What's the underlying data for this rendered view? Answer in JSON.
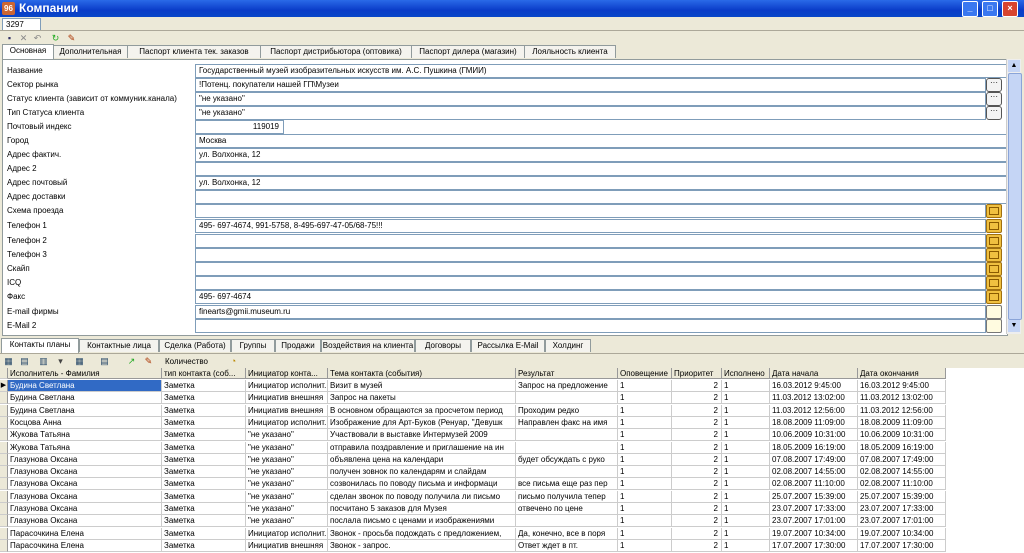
{
  "window": {
    "title": "Компании",
    "app_icon_text": "96",
    "record_id": "3297"
  },
  "tabs": [
    "Основная",
    "Дополнительная",
    "Паспорт клиента тек. заказов",
    "Паспорт дистрибьютора (оптовика)",
    "Паспорт дилера (магазин)",
    "Лояльность клиента"
  ],
  "fields": [
    {
      "label": "Название",
      "value": "Государственный музей изобразительных искусств им. А.С. Пушкина (ГМИИ)",
      "btn": ""
    },
    {
      "label": "Сектор рынка",
      "value": "!Потенц. покупатели нашей ГП\\Музеи",
      "btn": "dots"
    },
    {
      "label": "Статус клиента (зависит от коммуник.канала)",
      "value": "\"не указано\"",
      "btn": "dots"
    },
    {
      "label": "Тип Статуса клиента",
      "value": "\"не указано\"",
      "btn": "dots"
    },
    {
      "label": "Почтовый индекс",
      "value": "119019",
      "btn": ""
    },
    {
      "label": "Город",
      "value": "Москва",
      "btn": ""
    },
    {
      "label": "Адрес фактич.",
      "value": "ул. Волхонка, 12",
      "btn": ""
    },
    {
      "label": "Адрес 2",
      "value": "",
      "btn": ""
    },
    {
      "label": "Адрес почтовый",
      "value": "ул. Волхонка, 12",
      "btn": ""
    },
    {
      "label": "Адрес доставки",
      "value": "",
      "btn": ""
    },
    {
      "label": "Схема проезда",
      "value": "",
      "btn": "env"
    },
    {
      "label": "Телефон 1",
      "value": "495- 697-4674, 991-5758,  8-495-697-47-05/68-75!!!",
      "btn": "env"
    },
    {
      "label": "Телефон 2",
      "value": "",
      "btn": "env"
    },
    {
      "label": "Телефон 3",
      "value": "",
      "btn": "env"
    },
    {
      "label": "Скайп",
      "value": "",
      "btn": "env"
    },
    {
      "label": "ICQ",
      "value": "",
      "btn": "env"
    },
    {
      "label": "Факс",
      "value": "495- 697-4674",
      "btn": "env"
    },
    {
      "label": "E-mail фирмы",
      "value": "finearts@gmii.museum.ru",
      "btn": "page"
    },
    {
      "label": "E-Mail 2",
      "value": "",
      "btn": "page"
    }
  ],
  "bottom_tabs": [
    "Контакты планы",
    "Контактные лица",
    "Сделка (Работа)",
    "Группы",
    "Продажи",
    "Воздействия на клиента",
    "Договоры",
    "Рассылка E-Mail",
    "Холдинг"
  ],
  "bottom_toolbar": {
    "count_label": "Количество"
  },
  "grid": {
    "columns": [
      "Исполнитель - Фамилия",
      "тип контакта (соб...",
      "Инициатор конта...",
      "Тема контакта (события)",
      "Результат",
      "Оповещение",
      "Приоритет",
      "Исполнено",
      "Дата начала",
      "Дата окончания"
    ],
    "rows": [
      [
        "Будина Светлана",
        "Заметка",
        "Инициатор исполнит.",
        "Визит в музей",
        "Запрос на предложение",
        "1",
        "2",
        "1",
        "16.03.2012 9:45:00",
        "16.03.2012 9:45:00"
      ],
      [
        "Будина Светлана",
        "Заметка",
        "Инициатив внешняя",
        "Запрос на пакеты",
        "",
        "1",
        "2",
        "1",
        "11.03.2012 13:02:00",
        "11.03.2012 13:02:00"
      ],
      [
        "Будина Светлана",
        "Заметка",
        "Инициатив внешняя",
        "В основном обращаются за просчетом период",
        "Проходим редко",
        "1",
        "2",
        "1",
        "11.03.2012 12:56:00",
        "11.03.2012 12:56:00"
      ],
      [
        "Косцова Анна",
        "Заметка",
        "Инициатор исполнит.",
        "Изображение для Арт-Буков (Ренуар, \"Девушк",
        "Направлен факс на имя",
        "1",
        "2",
        "1",
        "18.08.2009 11:09:00",
        "18.08.2009 11:09:00"
      ],
      [
        "Жукова Татьяна",
        "Заметка",
        "\"не указано\"",
        "Участвовали в выставке Интермузей 2009",
        "",
        "1",
        "2",
        "1",
        "10.06.2009 10:31:00",
        "10.06.2009 10:31:00"
      ],
      [
        "Жукова Татьяна",
        "Заметка",
        "\"не указано\"",
        "отправила поздравление и приглашение на ин",
        "",
        "1",
        "2",
        "1",
        "18.05.2009 16:19:00",
        "18.05.2009 16:19:00"
      ],
      [
        "Глазунова Оксана",
        "Заметка",
        "\"не указано\"",
        "объявлена цена на календари",
        "будет обсуждать с руко",
        "1",
        "2",
        "1",
        "07.08.2007 17:49:00",
        "07.08.2007 17:49:00"
      ],
      [
        "Глазунова Оксана",
        "Заметка",
        "\"не указано\"",
        "получен зовнок по календарям и слайдам",
        "",
        "1",
        "2",
        "1",
        "02.08.2007 14:55:00",
        "02.08.2007 14:55:00"
      ],
      [
        "Глазунова Оксана",
        "Заметка",
        "\"не указано\"",
        "созвонилась по поводу письма и информаци",
        "все письма еще раз пер",
        "1",
        "2",
        "1",
        "02.08.2007 11:10:00",
        "02.08.2007 11:10:00"
      ],
      [
        "Глазунова Оксана",
        "Заметка",
        "\"не указано\"",
        "сделан звонок по поводу получила ли письмо",
        "письмо получила тепер",
        "1",
        "2",
        "1",
        "25.07.2007 15:39:00",
        "25.07.2007 15:39:00"
      ],
      [
        "Глазунова Оксана",
        "Заметка",
        "\"не указано\"",
        "посчитано 5 заказов для Музея",
        "отвечено по цене",
        "1",
        "2",
        "1",
        "23.07.2007 17:33:00",
        "23.07.2007 17:33:00"
      ],
      [
        "Глазунова Оксана",
        "Заметка",
        "\"не указано\"",
        "послала письмо с ценами и изображениями",
        "",
        "1",
        "2",
        "1",
        "23.07.2007 17:01:00",
        "23.07.2007 17:01:00"
      ],
      [
        "Парасочкина Елена",
        "Заметка",
        "Инициатор исполнит.",
        "Звонок - просьба подождать с предложением,",
        "Да, конечно, все в поря",
        "1",
        "2",
        "1",
        "19.07.2007 10:34:00",
        "19.07.2007 10:34:00"
      ],
      [
        "Парасочкина Елена",
        "Заметка",
        "Инициатив внешняя",
        "Звонок - запрос.",
        "Ответ ждет в пт.",
        "1",
        "2",
        "1",
        "17.07.2007 17:30:00",
        "17.07.2007 17:30:00"
      ]
    ]
  }
}
